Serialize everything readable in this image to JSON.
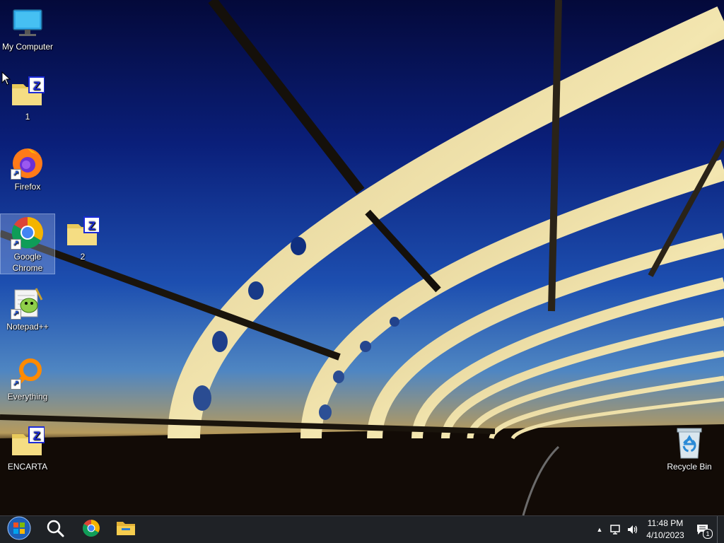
{
  "desktop": {
    "icons": [
      {
        "label": "My Computer"
      },
      {
        "label": "1"
      },
      {
        "label": "Firefox"
      },
      {
        "label": "Google Chrome"
      },
      {
        "label": "2"
      },
      {
        "label": "Notepad++"
      },
      {
        "label": "Everything"
      },
      {
        "label": "ENCARTA"
      },
      {
        "label": "Recycle Bin"
      }
    ],
    "shortcut_arrow": "↗",
    "folder_badge": "Z"
  },
  "taskbar": {
    "pinned": [
      "start-button",
      "search",
      "google-chrome",
      "file-explorer"
    ],
    "tray": {
      "overflow_arrow": "▲",
      "time": "11:48 PM",
      "date": "4/10/2023",
      "notification_count": "1"
    }
  },
  "colors": {
    "taskbar": "#1f2226",
    "selection": "#c8dcff",
    "folder_badge": "#1c2bd8"
  }
}
